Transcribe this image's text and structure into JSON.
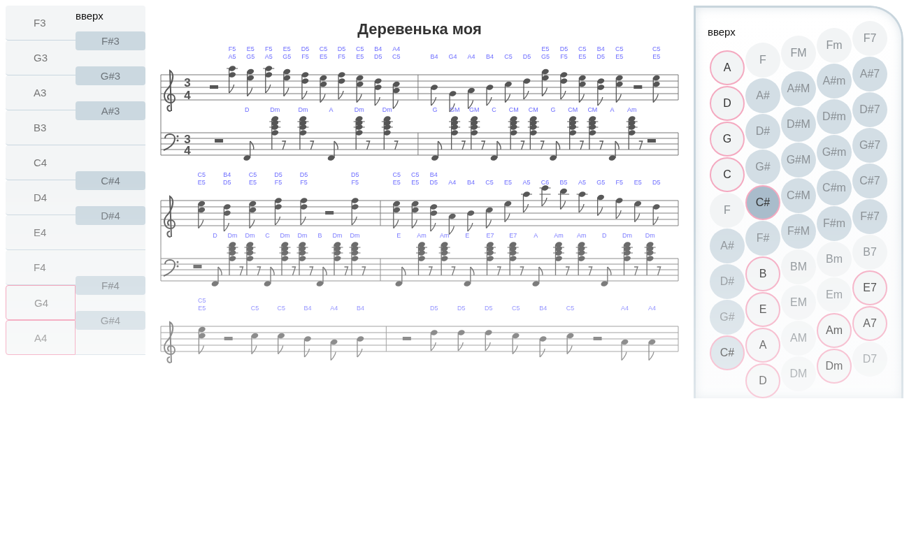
{
  "left_keyboard": {
    "label": "вверх",
    "keys": [
      {
        "label": "F3",
        "sharp": "F#3",
        "selected": false
      },
      {
        "label": "G3",
        "sharp": "G#3",
        "selected": false
      },
      {
        "label": "A3",
        "sharp": "A#3",
        "selected": false
      },
      {
        "label": "B3",
        "selected": false
      },
      {
        "label": "C4",
        "sharp": "C#4",
        "selected": false
      },
      {
        "label": "D4",
        "sharp": "D#4",
        "selected": false
      },
      {
        "label": "E4",
        "selected": false
      },
      {
        "label": "F4",
        "sharp": "F#4",
        "selected": false
      },
      {
        "label": "G4",
        "sharp": "G#4",
        "selected": true
      },
      {
        "label": "A4",
        "selected": true
      }
    ]
  },
  "score": {
    "title": "Деревенька моя",
    "systems": [
      {
        "treble": {
          "time": [
            "3",
            "4"
          ],
          "measures": [
            [
              {
                "kind": "rest"
              },
              {
                "kind": "note",
                "notes": [
                  "F5",
                  "A5"
                ]
              },
              {
                "kind": "note",
                "notes": [
                  "E5",
                  "G5"
                ]
              },
              {
                "kind": "note",
                "notes": [
                  "F5",
                  "A5"
                ]
              },
              {
                "kind": "note",
                "notes": [
                  "E5",
                  "G5"
                ]
              },
              {
                "kind": "note",
                "notes": [
                  "D5",
                  "F5"
                ]
              },
              {
                "kind": "note",
                "notes": [
                  "C5",
                  "E5"
                ]
              },
              {
                "kind": "note",
                "notes": [
                  "D5",
                  "F5"
                ]
              },
              {
                "kind": "note",
                "notes": [
                  "C5",
                  "E5"
                ]
              },
              {
                "kind": "note",
                "notes": [
                  "B4",
                  "D5"
                ]
              },
              {
                "kind": "note",
                "notes": [
                  "A4",
                  "C5"
                ]
              }
            ],
            [
              {
                "kind": "note",
                "notes": [
                  "B4"
                ]
              },
              {
                "kind": "note",
                "notes": [
                  "G4"
                ]
              },
              {
                "kind": "note",
                "notes": [
                  "A4"
                ]
              },
              {
                "kind": "note",
                "notes": [
                  "B4"
                ]
              },
              {
                "kind": "note",
                "notes": [
                  "C5"
                ]
              },
              {
                "kind": "note",
                "notes": [
                  "D5"
                ]
              },
              {
                "kind": "note",
                "notes": [
                  "E5",
                  "G5"
                ]
              },
              {
                "kind": "note",
                "notes": [
                  "D5",
                  "F5"
                ]
              },
              {
                "kind": "note",
                "notes": [
                  "C5",
                  "E5"
                ]
              },
              {
                "kind": "note",
                "notes": [
                  "B4",
                  "D5"
                ]
              },
              {
                "kind": "note",
                "notes": [
                  "C5",
                  "E5"
                ]
              },
              {
                "kind": "rest"
              },
              {
                "kind": "note",
                "notes": [
                  "C5",
                  "E5"
                ]
              }
            ]
          ]
        },
        "bass": {
          "time": [
            "3",
            "4"
          ],
          "measures": [
            [
              {
                "kind": "rest"
              },
              {
                "kind": "bass",
                "chord": "D"
              },
              {
                "kind": "chord",
                "chord": "Dm"
              },
              {
                "kind": "chord",
                "chord": "Dm"
              },
              {
                "kind": "bass",
                "chord": "A"
              },
              {
                "kind": "chord",
                "chord": "Dm"
              },
              {
                "kind": "chord",
                "chord": "Dm"
              }
            ],
            [
              {
                "kind": "bass",
                "chord": "G"
              },
              {
                "kind": "chord",
                "chord": "GM"
              },
              {
                "kind": "chord",
                "chord": "GM"
              },
              {
                "kind": "bass",
                "chord": "C"
              },
              {
                "kind": "chord",
                "chord": "CM"
              },
              {
                "kind": "chord",
                "chord": "CM"
              },
              {
                "kind": "bass",
                "chord": "G"
              },
              {
                "kind": "chord",
                "chord": "CM"
              },
              {
                "kind": "chord",
                "chord": "CM"
              },
              {
                "kind": "bass",
                "chord": "A"
              },
              {
                "kind": "chord",
                "chord": "Am"
              },
              {
                "kind": "rest"
              }
            ]
          ]
        }
      },
      {
        "treble": {
          "measures": [
            [
              {
                "kind": "note",
                "notes": [
                  "C5",
                  "E5"
                ]
              },
              {
                "kind": "note",
                "notes": [
                  "B4",
                  "D5"
                ]
              },
              {
                "kind": "note",
                "notes": [
                  "C5",
                  "E5"
                ]
              },
              {
                "kind": "note",
                "notes": [
                  "D5",
                  "F5"
                ]
              },
              {
                "kind": "note",
                "notes": [
                  "D5",
                  "F5"
                ]
              },
              {
                "kind": "rest"
              },
              {
                "kind": "note",
                "notes": [
                  "D5",
                  "F5"
                ]
              }
            ],
            [
              {
                "kind": "note",
                "notes": [
                  "C5",
                  "E5"
                ]
              },
              {
                "kind": "note",
                "notes": [
                  "C5",
                  "E5"
                ]
              },
              {
                "kind": "note",
                "notes": [
                  "B4",
                  "D5"
                ]
              },
              {
                "kind": "note",
                "notes": [
                  "A4"
                ]
              },
              {
                "kind": "note",
                "notes": [
                  "B4"
                ]
              },
              {
                "kind": "note",
                "notes": [
                  "C5"
                ]
              },
              {
                "kind": "note",
                "notes": [
                  "E5"
                ]
              },
              {
                "kind": "note",
                "notes": [
                  "A5"
                ]
              },
              {
                "kind": "note",
                "notes": [
                  "C6"
                ]
              },
              {
                "kind": "note",
                "notes": [
                  "B5"
                ]
              },
              {
                "kind": "note",
                "notes": [
                  "A5"
                ]
              },
              {
                "kind": "note",
                "notes": [
                  "G5"
                ]
              },
              {
                "kind": "note",
                "notes": [
                  "F5"
                ]
              },
              {
                "kind": "note",
                "notes": [
                  "E5"
                ]
              },
              {
                "kind": "note",
                "notes": [
                  "D5"
                ]
              }
            ]
          ]
        },
        "bass": {
          "measures": [
            [
              {
                "kind": "rest"
              },
              {
                "kind": "bass",
                "chord": "D"
              },
              {
                "kind": "chord",
                "chord": "Dm"
              },
              {
                "kind": "chord",
                "chord": "Dm"
              },
              {
                "kind": "bass",
                "chord": "C"
              },
              {
                "kind": "chord",
                "chord": "Dm"
              },
              {
                "kind": "chord",
                "chord": "Dm"
              },
              {
                "kind": "bass",
                "chord": "B"
              },
              {
                "kind": "chord",
                "chord": "Dm"
              },
              {
                "kind": "chord",
                "chord": "Dm"
              }
            ],
            [
              {
                "kind": "bass",
                "chord": "E"
              },
              {
                "kind": "chord",
                "chord": "Am"
              },
              {
                "kind": "chord",
                "chord": "Am"
              },
              {
                "kind": "bass",
                "chord": "E"
              },
              {
                "kind": "chord",
                "chord": "E7"
              },
              {
                "kind": "chord",
                "chord": "E7"
              },
              {
                "kind": "bass",
                "chord": "A"
              },
              {
                "kind": "chord",
                "chord": "Am"
              },
              {
                "kind": "chord",
                "chord": "Am"
              },
              {
                "kind": "bass",
                "chord": "D"
              },
              {
                "kind": "chord",
                "chord": "Dm"
              },
              {
                "kind": "chord",
                "chord": "Dm"
              }
            ]
          ]
        }
      },
      {
        "treble": {
          "measures": [
            [
              {
                "kind": "note",
                "notes": [
                  "C5",
                  "E5"
                ]
              },
              {
                "kind": "rest"
              },
              {
                "kind": "note",
                "notes": [
                  "C5"
                ]
              },
              {
                "kind": "note",
                "notes": [
                  "C5"
                ]
              },
              {
                "kind": "note",
                "notes": [
                  "B4"
                ]
              },
              {
                "kind": "note",
                "notes": [
                  "A4"
                ]
              },
              {
                "kind": "note",
                "notes": [
                  "B4"
                ]
              }
            ],
            [
              {
                "kind": "rest"
              },
              {
                "kind": "note",
                "notes": [
                  "D5"
                ]
              },
              {
                "kind": "note",
                "notes": [
                  "D5"
                ]
              },
              {
                "kind": "note",
                "notes": [
                  "D5"
                ]
              },
              {
                "kind": "note",
                "notes": [
                  "C5"
                ]
              },
              {
                "kind": "note",
                "notes": [
                  "B4"
                ]
              },
              {
                "kind": "note",
                "notes": [
                  "C5"
                ]
              },
              {
                "kind": "rest"
              },
              {
                "kind": "note",
                "notes": [
                  "A4"
                ]
              },
              {
                "kind": "note",
                "notes": [
                  "A4"
                ]
              }
            ]
          ]
        }
      }
    ]
  },
  "chord_panel": {
    "label": "вверх",
    "columns": [
      {
        "buttons": [
          {
            "label": "A",
            "kind": "natural",
            "selected": true,
            "pressed": false
          },
          {
            "label": "D",
            "kind": "natural",
            "selected": true,
            "pressed": false
          },
          {
            "label": "G",
            "kind": "natural",
            "selected": true,
            "pressed": false
          },
          {
            "label": "C",
            "kind": "natural",
            "selected": true,
            "pressed": false
          },
          {
            "label": "F",
            "kind": "natural",
            "selected": false,
            "pressed": false
          },
          {
            "label": "A#",
            "kind": "sharp",
            "selected": false,
            "pressed": false
          },
          {
            "label": "D#",
            "kind": "sharp",
            "selected": false,
            "pressed": false
          },
          {
            "label": "G#",
            "kind": "sharp",
            "selected": false,
            "pressed": false
          },
          {
            "label": "C#",
            "kind": "sharp",
            "selected": true,
            "pressed": false
          }
        ]
      },
      {
        "buttons": [
          {
            "label": "F",
            "kind": "natural",
            "selected": false,
            "pressed": false
          },
          {
            "label": "A#",
            "kind": "sharp",
            "selected": false,
            "pressed": false
          },
          {
            "label": "D#",
            "kind": "sharp",
            "selected": false,
            "pressed": false
          },
          {
            "label": "G#",
            "kind": "sharp",
            "selected": false,
            "pressed": false
          },
          {
            "label": "C#",
            "kind": "sharp",
            "selected": true,
            "pressed": true
          },
          {
            "label": "F#",
            "kind": "sharp",
            "selected": false,
            "pressed": false
          },
          {
            "label": "B",
            "kind": "natural",
            "selected": true,
            "pressed": false
          },
          {
            "label": "E",
            "kind": "natural",
            "selected": true,
            "pressed": false
          },
          {
            "label": "A",
            "kind": "natural",
            "selected": true,
            "pressed": false
          },
          {
            "label": "D",
            "kind": "natural",
            "selected": true,
            "pressed": false
          }
        ]
      },
      {
        "buttons": [
          {
            "label": "FM",
            "kind": "natural",
            "selected": false,
            "pressed": false
          },
          {
            "label": "A#M",
            "kind": "sharp",
            "selected": false,
            "pressed": false
          },
          {
            "label": "D#M",
            "kind": "sharp",
            "selected": false,
            "pressed": false
          },
          {
            "label": "G#M",
            "kind": "sharp",
            "selected": false,
            "pressed": false
          },
          {
            "label": "C#M",
            "kind": "sharp",
            "selected": false,
            "pressed": false
          },
          {
            "label": "F#M",
            "kind": "sharp",
            "selected": false,
            "pressed": false
          },
          {
            "label": "BM",
            "kind": "natural",
            "selected": false,
            "pressed": false
          },
          {
            "label": "EM",
            "kind": "natural",
            "selected": false,
            "pressed": false
          },
          {
            "label": "AM",
            "kind": "natural",
            "selected": false,
            "pressed": false
          },
          {
            "label": "DM",
            "kind": "natural",
            "selected": false,
            "pressed": false
          }
        ]
      },
      {
        "buttons": [
          {
            "label": "Fm",
            "kind": "natural",
            "selected": false,
            "pressed": false
          },
          {
            "label": "A#m",
            "kind": "sharp",
            "selected": false,
            "pressed": false
          },
          {
            "label": "D#m",
            "kind": "sharp",
            "selected": false,
            "pressed": false
          },
          {
            "label": "G#m",
            "kind": "sharp",
            "selected": false,
            "pressed": false
          },
          {
            "label": "C#m",
            "kind": "sharp",
            "selected": false,
            "pressed": false
          },
          {
            "label": "F#m",
            "kind": "sharp",
            "selected": false,
            "pressed": false
          },
          {
            "label": "Bm",
            "kind": "natural",
            "selected": false,
            "pressed": false
          },
          {
            "label": "Em",
            "kind": "natural",
            "selected": false,
            "pressed": false
          },
          {
            "label": "Am",
            "kind": "natural",
            "selected": true,
            "pressed": false
          },
          {
            "label": "Dm",
            "kind": "natural",
            "selected": true,
            "pressed": false
          }
        ]
      },
      {
        "buttons": [
          {
            "label": "F7",
            "kind": "natural",
            "selected": false,
            "pressed": false
          },
          {
            "label": "A#7",
            "kind": "sharp",
            "selected": false,
            "pressed": false
          },
          {
            "label": "D#7",
            "kind": "sharp",
            "selected": false,
            "pressed": false
          },
          {
            "label": "G#7",
            "kind": "sharp",
            "selected": false,
            "pressed": false
          },
          {
            "label": "C#7",
            "kind": "sharp",
            "selected": false,
            "pressed": false
          },
          {
            "label": "F#7",
            "kind": "sharp",
            "selected": false,
            "pressed": false
          },
          {
            "label": "B7",
            "kind": "natural",
            "selected": false,
            "pressed": false
          },
          {
            "label": "E7",
            "kind": "natural",
            "selected": true,
            "pressed": false
          },
          {
            "label": "A7",
            "kind": "natural",
            "selected": true,
            "pressed": false
          },
          {
            "label": "D7",
            "kind": "natural",
            "selected": false,
            "pressed": false
          }
        ]
      }
    ]
  }
}
